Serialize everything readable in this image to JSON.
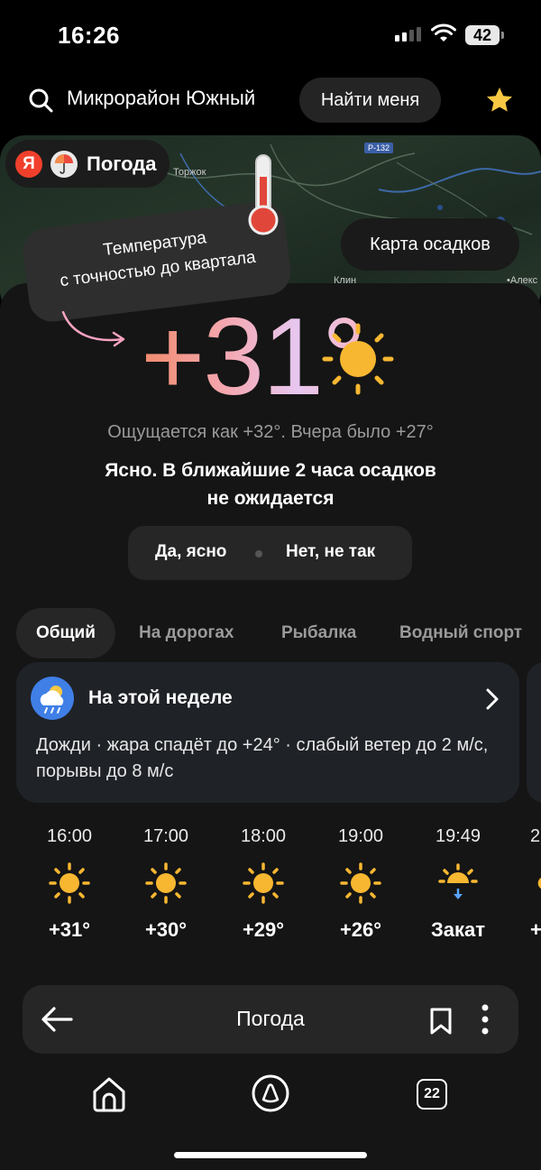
{
  "status_bar": {
    "time": "16:26",
    "battery": "42"
  },
  "header": {
    "location": "Микрорайон Южный",
    "find_me_label": "Найти меня"
  },
  "map": {
    "brand_letter": "Я",
    "brand_label": "Погода",
    "place_torzhok": "Торжок",
    "road_label": "Р-132",
    "place_klin": "Клин",
    "place_alex": "•Алекс",
    "precip_button": "Карта осадков"
  },
  "tooltip": {
    "line1": "Температура",
    "line2": "с точностью до квартала"
  },
  "current": {
    "temperature": "+31°",
    "feels_like": "Ощущается как +32°. Вчера было +27°",
    "description_line1": "Ясно. В ближайшие 2 часа осадков",
    "description_line2": "не ожидается",
    "icon": "sun-icon"
  },
  "feedback": {
    "yes_label": "Да, ясно",
    "no_label": "Нет, не так"
  },
  "tabs": [
    {
      "label": "Общий",
      "active": true
    },
    {
      "label": "На дорогах",
      "active": false
    },
    {
      "label": "Рыбалка",
      "active": false
    },
    {
      "label": "Водный спорт",
      "active": false
    }
  ],
  "week": {
    "title": "На этой неделе",
    "icon": "rain-cloud-icon",
    "text": "Дожди · жара спадёт до +24° · слабый ветер до 2 м/с, порывы до 8 м/с"
  },
  "hourly": [
    {
      "time": "16:00",
      "value": "+31°",
      "icon": "sun-icon"
    },
    {
      "time": "17:00",
      "value": "+30°",
      "icon": "sun-icon"
    },
    {
      "time": "18:00",
      "value": "+29°",
      "icon": "sun-icon"
    },
    {
      "time": "19:00",
      "value": "+26°",
      "icon": "sun-icon"
    },
    {
      "time": "19:49",
      "value": "Закат",
      "icon": "sunset-icon"
    },
    {
      "time": "2",
      "value": "+",
      "icon": "sun-icon"
    }
  ],
  "browser_bar": {
    "title": "Погода"
  },
  "bottom_nav": {
    "tabs_count": "22"
  },
  "colors": {
    "accent_sun": "#f7b731",
    "background": "#000000",
    "card": "#151515"
  }
}
